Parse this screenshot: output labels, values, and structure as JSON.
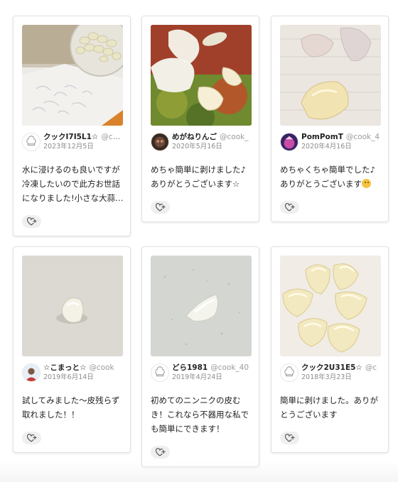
{
  "cards": [
    {
      "author": "クックI7I5L1☆",
      "author_id": "@cook_",
      "date": "2023年12月5日",
      "comment": "水に浸けるのも良いですが冷凍したいので此方お世話になりました!小さな大蒜の皮むきも楽ちんでした!",
      "avatar": "chef-hat-avatar",
      "photo": "peeled-garlic-bowl-photo"
    },
    {
      "author": "めがねりんご",
      "author_id": "@cook_",
      "date": "2020年5月16日",
      "comment": "めちゃ簡単に剥けました♪ありがとうございます☆",
      "avatar": "user-photo-avatar",
      "photo": "garlic-cloves-photo"
    },
    {
      "author": "PomPomT",
      "author_id": "@cook_4",
      "date": "2020年4月16日",
      "comment": "めちゃくちゃ簡単でした♪ありがとうございます",
      "comment_emoji": "smile-emoji",
      "avatar": "user-photo-avatar",
      "photo": "garlic-skin-photo"
    },
    {
      "author": "☆こまっと☆",
      "author_id": "@cook",
      "date": "2019年6月14日",
      "comment": "試してみました〜皮残らず取れました！！",
      "avatar": "user-photo-avatar",
      "photo": "single-garlic-clove-photo"
    },
    {
      "author": "どら1981",
      "author_id": "@cook_40",
      "date": "2019年4月24日",
      "comment": "初めてのニンニクの皮むき！これなら不器用な私でも簡単にできます！",
      "avatar": "chef-hat-avatar",
      "photo": "garlic-clove-on-board-photo"
    },
    {
      "author": "クック2U31E5☆",
      "author_id": "@c",
      "date": "2018年3月23日",
      "comment": "簡単に剥けました。ありがとうございます",
      "avatar": "chef-hat-avatar",
      "photo": "peeled-garlic-cloves-photo"
    }
  ],
  "like_button_icon": "heart-plus-icon"
}
